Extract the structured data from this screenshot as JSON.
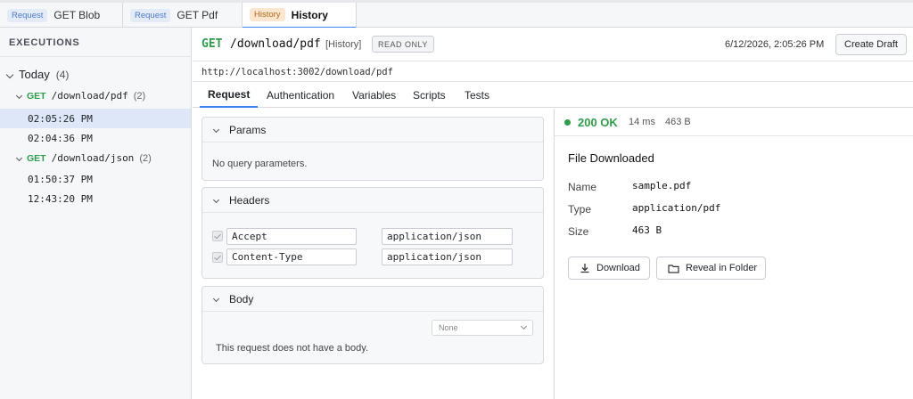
{
  "tabs": [
    {
      "badge": "Request",
      "label": "GET Blob",
      "active": false
    },
    {
      "badge": "Request",
      "label": "GET Pdf",
      "active": false
    },
    {
      "badge": "History",
      "label": "History",
      "active": true
    }
  ],
  "sidebar": {
    "title": "EXECUTIONS",
    "group": {
      "label": "Today",
      "count": "(4)"
    },
    "endpoints": [
      {
        "method": "GET",
        "path": "/download/pdf",
        "count": "(2)",
        "executions": [
          "02:05:26 PM",
          "02:04:36 PM"
        ]
      },
      {
        "method": "GET",
        "path": "/download/json",
        "count": "(2)",
        "executions": [
          "01:50:37 PM",
          "12:43:20 PM"
        ]
      }
    ]
  },
  "header": {
    "method": "GET",
    "path": "/download/pdf",
    "history_tag": "[History]",
    "read_only": "READ ONLY",
    "timestamp": "6/12/2026, 2:05:26 PM",
    "create_draft": "Create Draft"
  },
  "url": "http://localhost:3002/download/pdf",
  "subtabs": [
    "Request",
    "Authentication",
    "Variables",
    "Scripts",
    "Tests"
  ],
  "request": {
    "params": {
      "title": "Params",
      "empty_text": "No query parameters."
    },
    "headers": {
      "title": "Headers",
      "rows": [
        {
          "key": "Accept",
          "value": "application/json"
        },
        {
          "key": "Content-Type",
          "value": "application/json"
        }
      ]
    },
    "body": {
      "title": "Body",
      "type_select": "None",
      "empty_text": "This request does not have a body."
    }
  },
  "response": {
    "status": "200 OK",
    "time": "14 ms",
    "size": "463 B",
    "title": "File Downloaded",
    "meta": [
      {
        "label": "Name",
        "value": "sample.pdf"
      },
      {
        "label": "Type",
        "value": "application/pdf"
      },
      {
        "label": "Size",
        "value": "463 B"
      }
    ],
    "download_button": "Download",
    "reveal_button": "Reveal in Folder"
  },
  "colors": {
    "accent": "#3b82f6",
    "success": "#2e9d4b",
    "selected_row": "#dde7f7"
  }
}
